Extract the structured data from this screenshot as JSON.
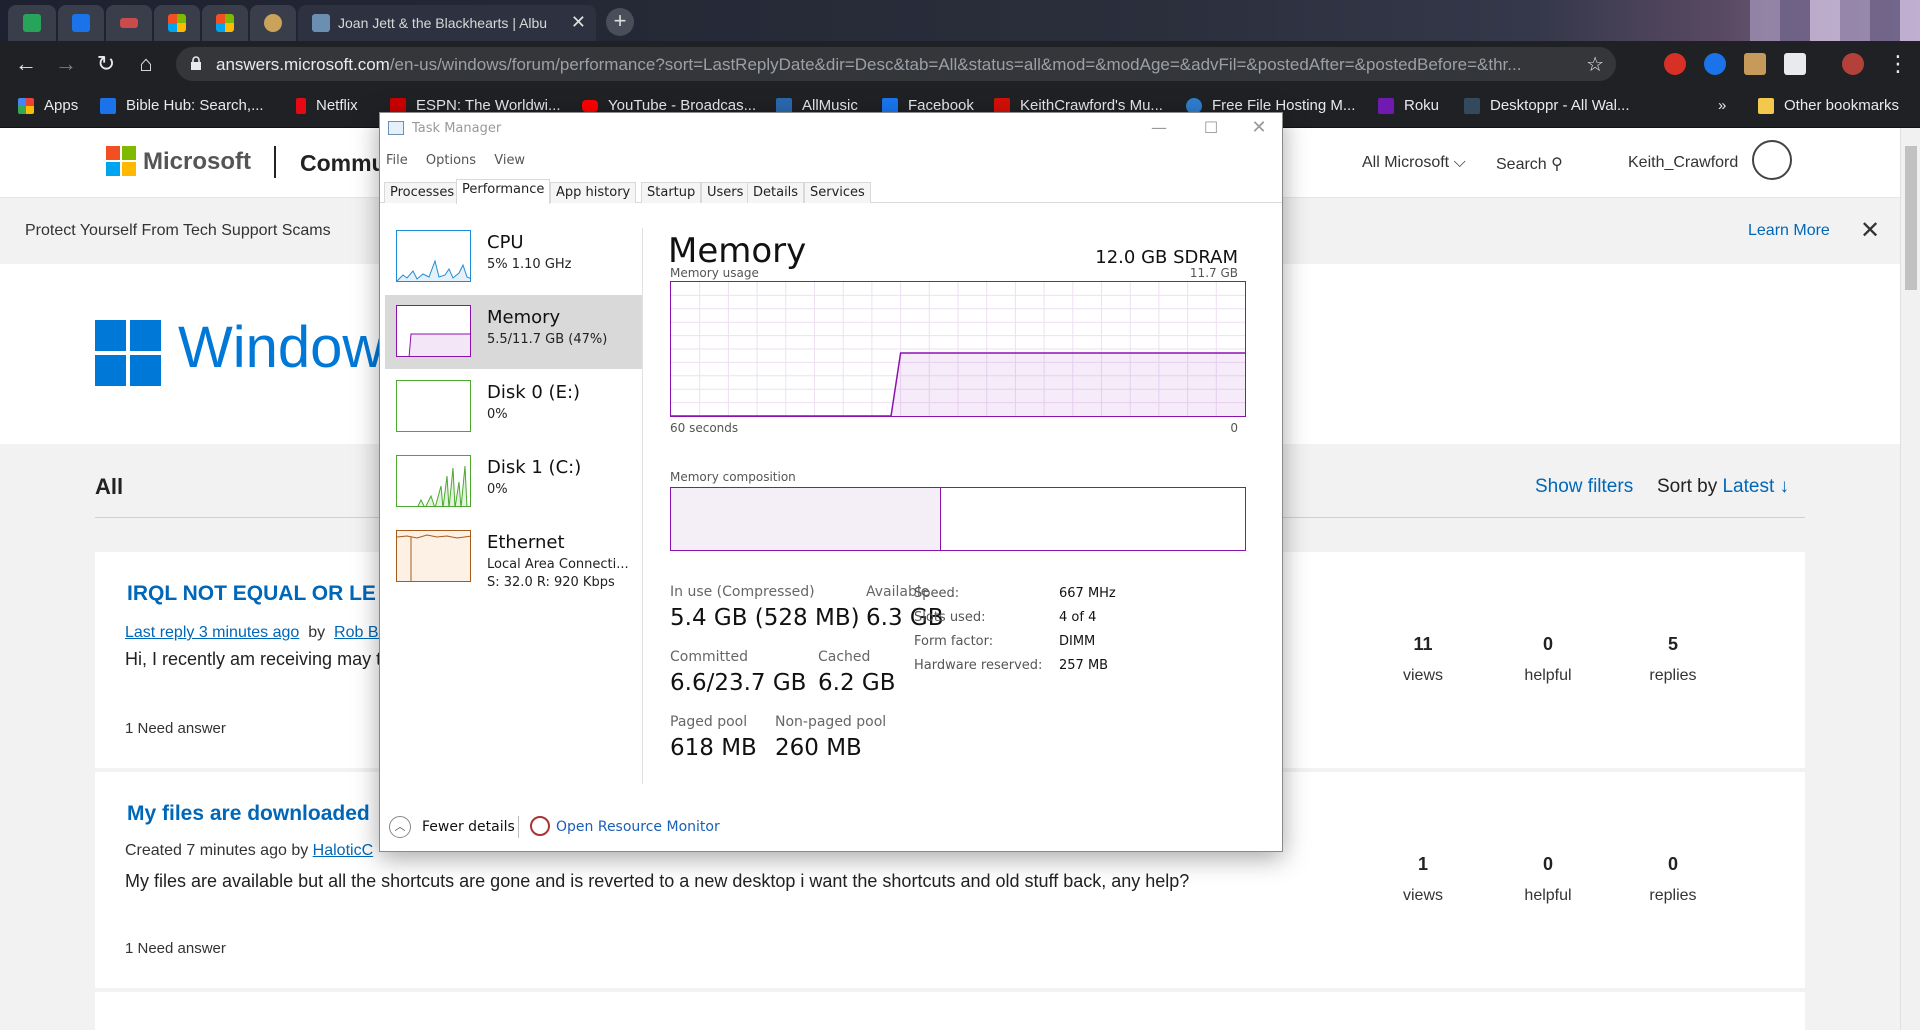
{
  "browser": {
    "tabs": [
      {
        "title": "",
        "favicon_color": "#27a35a"
      },
      {
        "title": "",
        "favicon_color": "#1a73e8"
      },
      {
        "title": "",
        "favicon_color": "#c94b4b"
      },
      {
        "title": "",
        "favicon_color": "#f25022"
      },
      {
        "title": "",
        "favicon_color": "#f25022"
      },
      {
        "title": "",
        "favicon_color": "#c9a35a"
      },
      {
        "title": "Joan Jett & the Blackhearts | Albu",
        "favicon_color": "#6b8fb0"
      }
    ],
    "url_host": "answers.microsoft.com",
    "url_path": "/en-us/windows/forum/performance?sort=LastReplyDate&dir=Desc&tab=All&status=all&mod=&modAge=&advFil=&postedAfter=&postedBefore=&thr...",
    "bookmarks": [
      {
        "label": "Apps",
        "color": "#ea4335"
      },
      {
        "label": "Bible Hub: Search,...",
        "color": "#1a73e8"
      },
      {
        "label": "Netflix",
        "color": "#e50914"
      },
      {
        "label": "ESPN: The Worldwi...",
        "color": "#cc0000"
      },
      {
        "label": "YouTube - Broadcas...",
        "color": "#ff0000"
      },
      {
        "label": "AllMusic",
        "color": "#2a6ab0"
      },
      {
        "label": "Facebook",
        "color": "#1877f2"
      },
      {
        "label": "KeithCrawford's Mu...",
        "color": "#d51007"
      },
      {
        "label": "Free File Hosting M...",
        "color": "#2f7fd1"
      },
      {
        "label": "Roku",
        "color": "#6f1ab1"
      },
      {
        "label": "Desktoppr - All Wal...",
        "color": "#34495e"
      }
    ],
    "bookmarks_overflow": "»",
    "other_bookmarks": "Other bookmarks"
  },
  "site": {
    "brand": "Microsoft",
    "community": "Commu",
    "all_microsoft": "All Microsoft",
    "search": "Search",
    "user": "Keith_Crawford",
    "banner_text": "Protect Yourself From Tech Support Scams",
    "banner_link": "Learn More",
    "hero_word": "Windows",
    "all_label": "All",
    "show_filters": "Show filters",
    "sort_by": "Sort by",
    "sort_value": "Latest",
    "threads": [
      {
        "title": "IRQL NOT EQUAL OR LE",
        "meta_link": "Last reply 3 minutes ago",
        "meta_by": "by",
        "meta_user": "Rob B.",
        "body": "Hi, I recently am receiving may the dump files of the 2 most re",
        "status": "1 Need answer",
        "views": "11",
        "helpful": "0",
        "replies": "5"
      },
      {
        "title": "My files are downloaded",
        "meta_prefix": "Created 7 minutes ago by",
        "meta_user": "HaloticC",
        "body": "My files are available but all the shortcuts are gone and is reverted to a new desktop i want the shortcuts and old stuff back, any help?",
        "status": "1 Need answer",
        "views": "1",
        "helpful": "0",
        "replies": "0"
      }
    ],
    "stat_labels": {
      "views": "views",
      "helpful": "helpful",
      "replies": "replies"
    }
  },
  "task_manager": {
    "title": "Task Manager",
    "menu": [
      "File",
      "Options",
      "View"
    ],
    "tabs": [
      "Processes",
      "Performance",
      "App history",
      "Startup",
      "Users",
      "Details",
      "Services"
    ],
    "active_tab": "Performance",
    "resources": [
      {
        "name": "CPU",
        "sub": "5%  1.10 GHz",
        "color": "#1f8dd6"
      },
      {
        "name": "Memory",
        "sub": "5.5/11.7 GB (47%)",
        "color": "#8b12ae"
      },
      {
        "name": "Disk 0 (E:)",
        "sub": "0%",
        "color": "#4ca72f"
      },
      {
        "name": "Disk 1 (C:)",
        "sub": "0%",
        "color": "#4ca72f"
      },
      {
        "name": "Ethernet",
        "sub": "Local Area Connecti...",
        "sub2": "S: 32.0  R: 920 Kbps",
        "color": "#a75b1a"
      }
    ],
    "memory": {
      "title": "Memory",
      "type": "12.0 GB SDRAM",
      "usage_label": "Memory usage",
      "usage_max": "11.7 GB",
      "time_label": "60 seconds",
      "time_end": "0",
      "composition_label": "Memory composition",
      "composition_in_use_fraction": 0.47,
      "usage_series": [
        0,
        0,
        0,
        0,
        0,
        0,
        0,
        0,
        0,
        0,
        0,
        0,
        0,
        0,
        0,
        0,
        0,
        0,
        0,
        0,
        0,
        0,
        0,
        0,
        0.47,
        0.47,
        0.47,
        0.47,
        0.47,
        0.47,
        0.47,
        0.47,
        0.47,
        0.47,
        0.47,
        0.47,
        0.47,
        0.47,
        0.47,
        0.47,
        0.47,
        0.47,
        0.47,
        0.47,
        0.47,
        0.47,
        0.47,
        0.47,
        0.47,
        0.47,
        0.47,
        0.47,
        0.47,
        0.47,
        0.47,
        0.47,
        0.47,
        0.47,
        0.47,
        0.47,
        0.47
      ],
      "in_use_label": "In use (Compressed)",
      "in_use": "5.4 GB (528 MB)",
      "available_label": "Available",
      "available": "6.3 GB",
      "committed_label": "Committed",
      "committed": "6.6/23.7 GB",
      "cached_label": "Cached",
      "cached": "6.2 GB",
      "paged_label": "Paged pool",
      "paged": "618 MB",
      "nonpaged_label": "Non-paged pool",
      "nonpaged": "260 MB",
      "speed_label": "Speed:",
      "speed": "667 MHz",
      "slots_label": "Slots used:",
      "slots": "4 of 4",
      "form_label": "Form factor:",
      "form": "DIMM",
      "reserved_label": "Hardware reserved:",
      "reserved": "257 MB"
    },
    "fewer_details": "Fewer details",
    "resource_monitor": "Open Resource Monitor"
  }
}
